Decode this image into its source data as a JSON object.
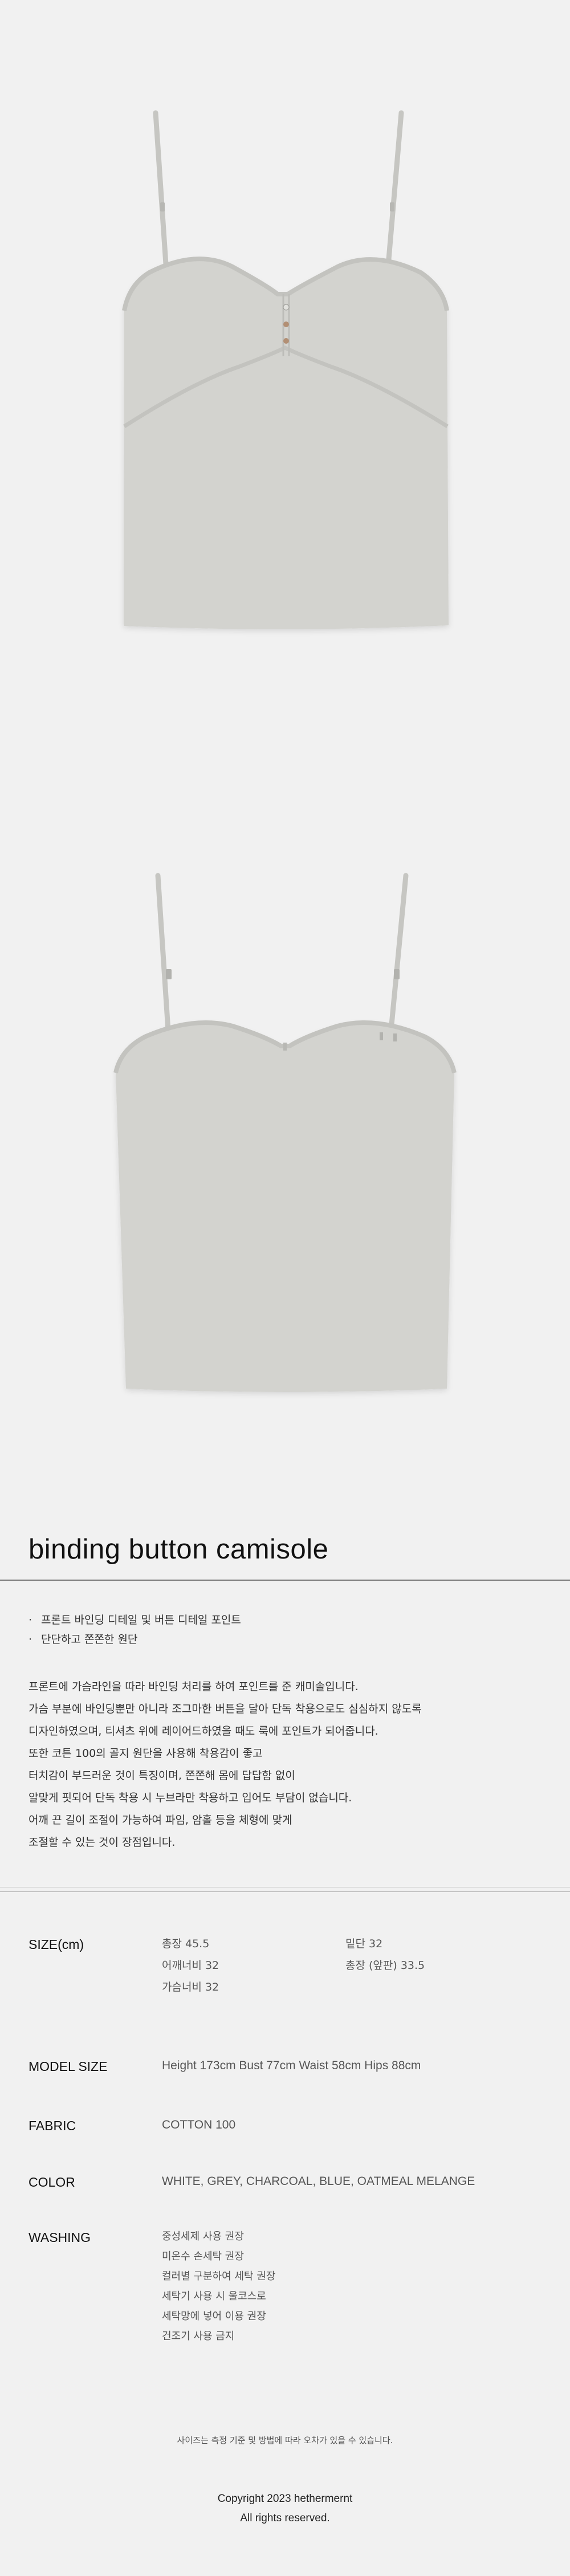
{
  "product": {
    "title": "binding button camisole"
  },
  "features": [
    "프론트 바인딩 디테일 및 버튼 디테일 포인트",
    "단단하고 쫀쫀한 원단"
  ],
  "description": [
    "프론트에 가슴라인을 따라 바인딩 처리를 하여 포인트를 준 캐미솔입니다.",
    "가슴 부분에 바인딩뿐만 아니라 조그마한 버튼을 달아 단독 착용으로도 심심하지 않도록",
    "디자인하였으며, 티셔츠 위에 레이어드하였을 때도 룩에 포인트가 되어줍니다.",
    "또한 코튼 100의 골지 원단을 사용해 착용감이 좋고",
    "터치감이 부드러운 것이 특징이며, 쫀쫀해 몸에 답답함 없이",
    "알맞게 핏되어 단독 착용 시 누브라만 착용하고 입어도 부담이 없습니다.",
    "어깨 끈 길이 조절이 가능하여 파임, 암홀 등을 체형에 맞게",
    "조절할 수 있는 것이 장점입니다."
  ],
  "size": {
    "label": "SIZE(cm)",
    "col1": [
      "총장 45.5",
      "어깨너비 32",
      "가슴너비 32"
    ],
    "col2": [
      "밑단 32",
      "총장 (앞판) 33.5"
    ]
  },
  "model_size": {
    "label": "MODEL SIZE",
    "value": "Height 173cm Bust 77cm Waist 58cm Hips 88cm"
  },
  "fabric": {
    "label": "FABRIC",
    "value": "COTTON 100"
  },
  "color": {
    "label": "COLOR",
    "value": "WHITE, GREY, CHARCOAL, BLUE, OATMEAL MELANGE"
  },
  "washing": {
    "label": "WASHING",
    "items": [
      "중성세제 사용 권장",
      "미온수 손세탁 권장",
      "컬러별 구분하여 세탁 권장",
      "세탁기 사용 시 울코스로",
      "세탁망에 넣어 이용 권장",
      "건조기 사용 금지"
    ]
  },
  "footnote": "사이즈는 측정 기준 및 방법에 따라 오차가 있을 수 있습니다.",
  "copyright": {
    "line1": "Copyright 2023 hethermernt",
    "line2": "All rights reserved."
  },
  "colors": {
    "background": "#f1f1f1",
    "fabric": "#d3d3cf",
    "binding": "#c9c9c5"
  },
  "icons": [
    "front-view-camisole-image",
    "back-view-camisole-image"
  ]
}
